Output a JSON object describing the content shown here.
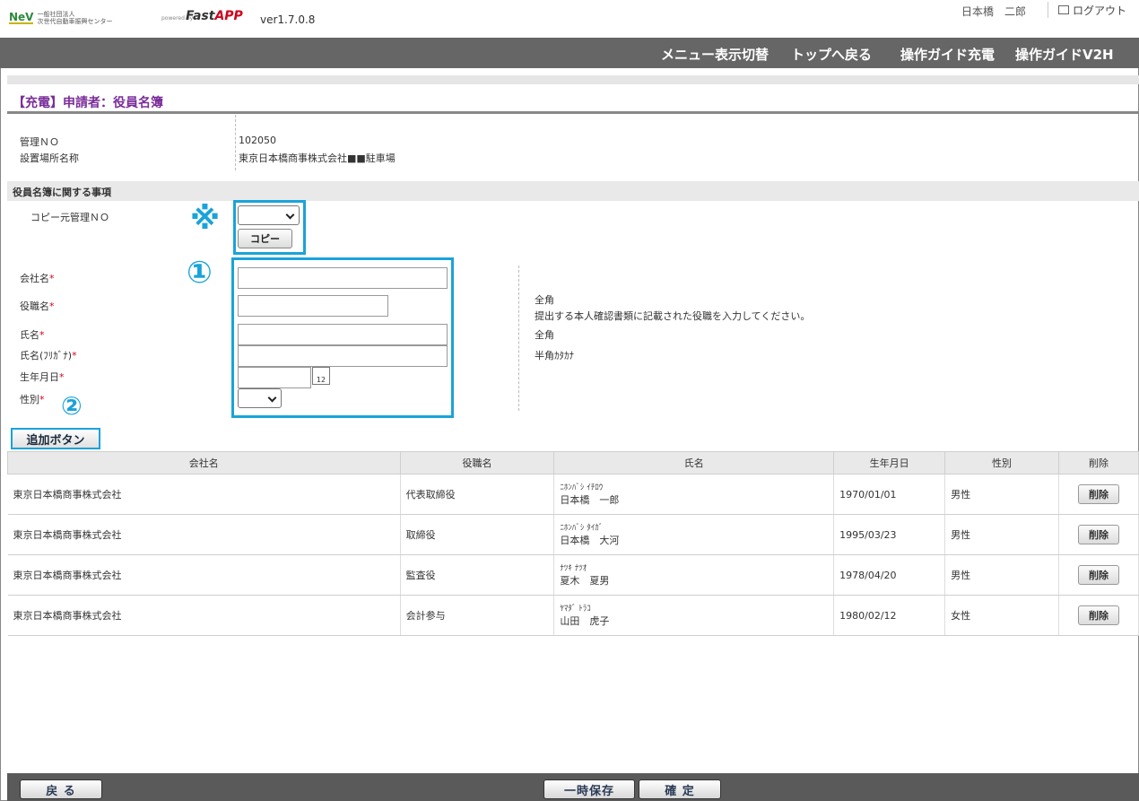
{
  "header": {
    "logo_mark": "NeV",
    "logo_org_line1": "一般社団法人",
    "logo_org_line2": "次世代自動車振興センター",
    "powered_by": "powered by",
    "product": "Fast",
    "product_accent": "APP",
    "version": "ver1.7.0.8",
    "user_name": "日本橋　二郎",
    "logout_label": "ログアウト"
  },
  "nav": {
    "items": [
      "メニュー表示切替",
      "トップへ戻る",
      "操作ガイド充電",
      "操作ガイドV2H"
    ]
  },
  "page": {
    "title": "【充電】申請者：役員名簿"
  },
  "info": {
    "mgmt_no_label": "管理ＮＯ",
    "mgmt_no_value": "102050",
    "site_name_label": "設置場所名称",
    "site_name_value": "東京日本橋商事株式会社■■駐車場"
  },
  "section": {
    "title": "役員名簿に関する事項",
    "copy_source_label": "コピー元管理ＮＯ",
    "copy_button": "コピー",
    "note_mark": "※",
    "mark_1": "①",
    "mark_2": "②"
  },
  "form": {
    "company_label": "会社名",
    "position_label": "役職名",
    "name_label": "氏名",
    "name_kana_label": "氏名(ﾌﾘｶﾞﾅ)",
    "birthdate_label": "生年月日",
    "gender_label": "性別",
    "required_mark": "*",
    "help_position_1": "全角",
    "help_position_2": "提出する本人確認書類に記載された役職を入力してください。",
    "help_name": "全角",
    "help_kana": "半角ｶﾀｶﾅ",
    "calendar_day": "12",
    "add_button": "追加ボタン"
  },
  "table": {
    "headers": [
      "会社名",
      "役職名",
      "氏名",
      "生年月日",
      "性別",
      "削除"
    ],
    "rows": [
      {
        "company": "東京日本橋商事株式会社",
        "position": "代表取締役",
        "kana": "ﾆﾎﾝﾊﾞｼ ｲﾁﾛｳ",
        "name": "日本橋　一郎",
        "birthdate": "1970/01/01",
        "gender": "男性",
        "delete": "削除"
      },
      {
        "company": "東京日本橋商事株式会社",
        "position": "取締役",
        "kana": "ﾆﾎﾝﾊﾞｼ ﾀｲｶﾞ",
        "name": "日本橋　大河",
        "birthdate": "1995/03/23",
        "gender": "男性",
        "delete": "削除"
      },
      {
        "company": "東京日本橋商事株式会社",
        "position": "監査役",
        "kana": "ﾅﾂｷ ﾅﾂｵ",
        "name": "夏木　夏男",
        "birthdate": "1978/04/20",
        "gender": "男性",
        "delete": "削除"
      },
      {
        "company": "東京日本橋商事株式会社",
        "position": "会計参与",
        "kana": "ﾔﾏﾀﾞ ﾄﾗｺ",
        "name": "山田　虎子",
        "birthdate": "1980/02/12",
        "gender": "女性",
        "delete": "削除"
      }
    ]
  },
  "footer": {
    "back_button": "戻 る",
    "temp_save_button": "一時保存",
    "confirm_button": "確 定"
  },
  "colors": {
    "nav_bg": "#666666",
    "title": "#7a2c99",
    "callout": "#1aa3d9",
    "required": "#d0021b"
  }
}
